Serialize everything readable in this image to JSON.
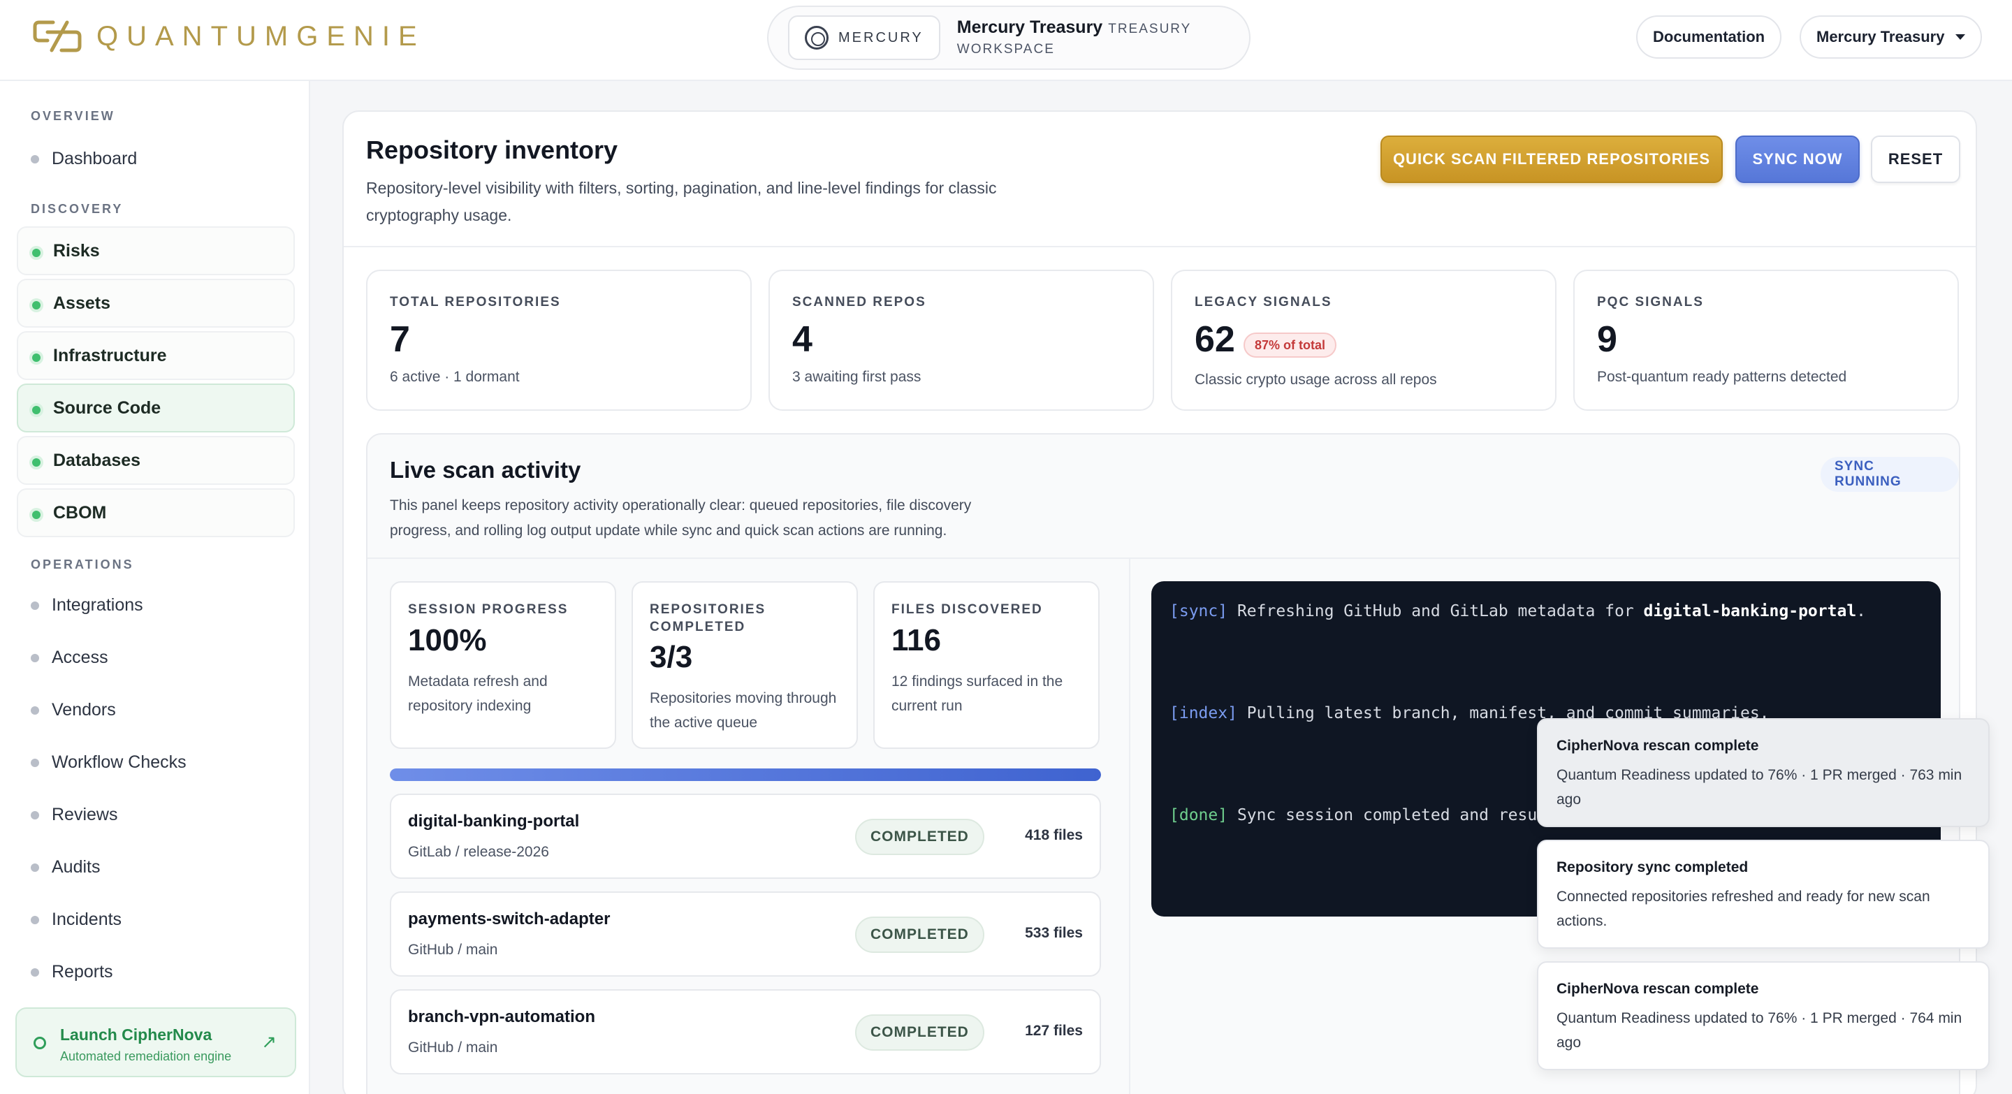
{
  "header": {
    "logo_text": "QUANTUMGENIE",
    "workspace_badge": "MERCURY",
    "workspace_name": "Mercury Treasury",
    "workspace_sub": "TREASURY WORKSPACE",
    "documentation": "Documentation",
    "account": "Mercury Treasury"
  },
  "sidebar": {
    "overview_title": "OVERVIEW",
    "overview_items": [
      "Dashboard"
    ],
    "discovery_title": "DISCOVERY",
    "discovery_items": [
      "Risks",
      "Assets",
      "Infrastructure",
      "Source Code",
      "Databases",
      "CBOM"
    ],
    "active_item": "Source Code",
    "operations_title": "OPERATIONS",
    "operations_items": [
      "Integrations",
      "Access",
      "Vendors",
      "Workflow Checks",
      "Reviews",
      "Audits",
      "Incidents",
      "Reports"
    ],
    "launch_title": "Launch CipherNova",
    "launch_sub": "Automated remediation engine"
  },
  "main": {
    "title": "Repository inventory",
    "description": "Repository-level visibility with filters, sorting, pagination, and line-level findings for classic cryptography usage.",
    "quick_scan": "QUICK SCAN FILTERED REPOSITORIES",
    "sync_now": "SYNC NOW",
    "reset": "RESET",
    "stats": [
      {
        "label": "TOTAL REPOSITORIES",
        "value": "7",
        "sub": "6 active · 1 dormant"
      },
      {
        "label": "SCANNED REPOS",
        "value": "4",
        "sub": "3 awaiting first pass"
      },
      {
        "label": "LEGACY SIGNALS",
        "value": "62",
        "badge": "87% of total",
        "sub": "Classic crypto usage across all repos"
      },
      {
        "label": "PQC SIGNALS",
        "value": "9",
        "sub": "Post-quantum ready patterns detected"
      }
    ]
  },
  "live": {
    "title": "Live scan activity",
    "description": "This panel keeps repository activity operationally clear: queued repositories, file discovery progress, and rolling log output update while sync and quick scan actions are running.",
    "status": "SYNC RUNNING",
    "progress_fraction": 1.0,
    "metrics": [
      {
        "label": "SESSION PROGRESS",
        "value": "100%",
        "sub": "Metadata refresh and repository indexing"
      },
      {
        "label": "REPOSITORIES COMPLETED",
        "value": "3/3",
        "sub": "Repositories moving through the active queue"
      },
      {
        "label": "FILES DISCOVERED",
        "value": "116",
        "sub": "12 findings surfaced in the current run"
      }
    ],
    "repos": [
      {
        "name": "digital-banking-portal",
        "branch": "GitLab / release-2026",
        "status": "COMPLETED",
        "files": "418 files"
      },
      {
        "name": "payments-switch-adapter",
        "branch": "GitHub / main",
        "status": "COMPLETED",
        "files": "533 files"
      },
      {
        "name": "branch-vpn-automation",
        "branch": "GitHub / main",
        "status": "COMPLETED",
        "files": "127 files"
      }
    ],
    "log": [
      {
        "tag": "[sync]",
        "text": " Refreshing GitHub and GitLab metadata for ",
        "strong": "digital-banking-portal",
        "tail": "."
      },
      {
        "tag": "[index]",
        "text": " Pulling latest branch, manifest, and commit summaries."
      },
      {
        "tag": "[done]",
        "text": " Sync session completed and results persisted to the workspace view."
      }
    ]
  },
  "toasts": [
    {
      "title": "CipherNova rescan complete",
      "body": "Quantum Readiness updated to 76% · 1 PR merged · 763 min ago"
    },
    {
      "title": "Repository sync completed",
      "body": "Connected repositories refreshed and ready for new scan actions."
    },
    {
      "title": "CipherNova rescan complete",
      "body": "Quantum Readiness updated to 76% · 1 PR merged · 764 min ago"
    }
  ],
  "colors": {
    "brand_gold": "#b39a4b",
    "accent_blue": "#5677d8",
    "success_green": "#3fbf6e",
    "danger_red": "#c43a3a",
    "terminal_bg": "#0f1623"
  }
}
